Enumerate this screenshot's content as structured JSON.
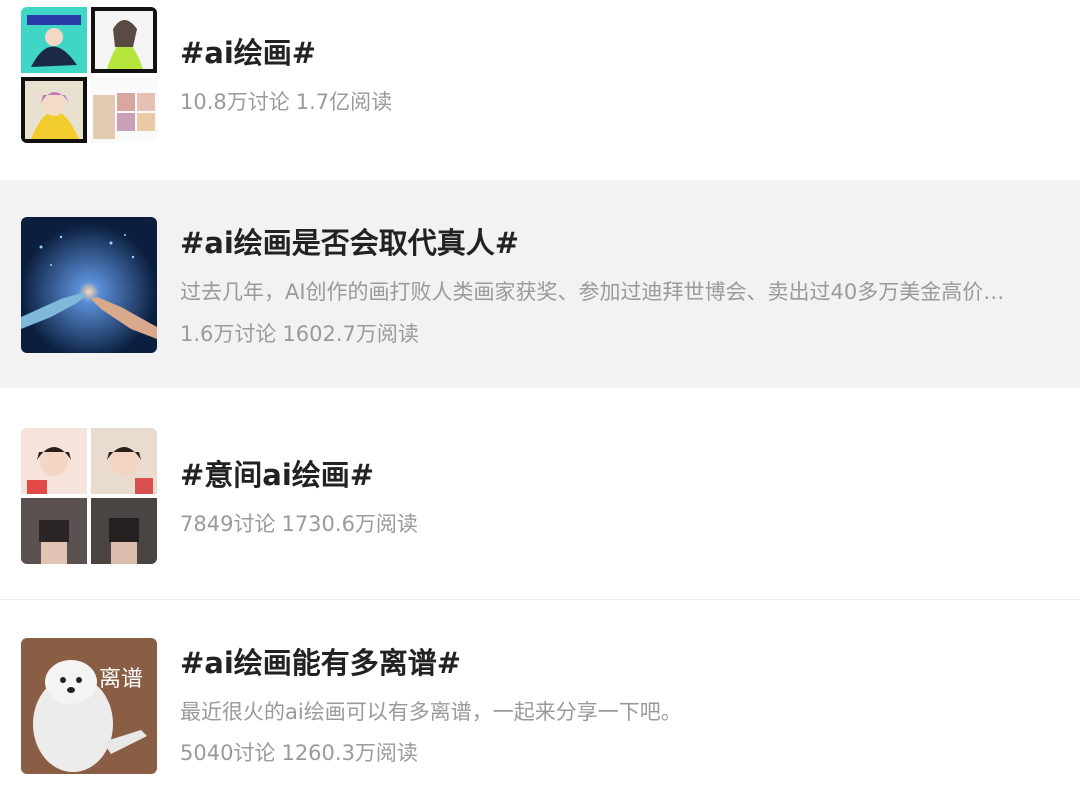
{
  "topics": [
    {
      "title": "#ai绘画#",
      "discussions": "10.8万讨论",
      "reads": "1.7亿阅读",
      "thumbnail_icon": "anime-collage-thumbnail"
    },
    {
      "title": "#ai绘画是否会取代真人#",
      "description": "过去几年，AI创作的画打败人类画家获奖、参加过迪拜世博会、卖出过40多万美金高价…",
      "discussions": "1.6万讨论",
      "reads": "1602.7万阅读",
      "thumbnail_icon": "robot-human-hands-thumbnail"
    },
    {
      "title": "#意间ai绘画#",
      "discussions": "7849讨论",
      "reads": "1730.6万阅读",
      "thumbnail_icon": "portrait-grid-thumbnail"
    },
    {
      "title": "#ai绘画能有多离谱#",
      "description": "最近很火的ai绘画可以有多离谱，一起来分享一下吧。",
      "discussions": "5040讨论",
      "reads": "1260.3万阅读",
      "thumbnail_icon": "dog-meme-thumbnail",
      "thumbnail_text": "离谱"
    }
  ],
  "colors": {
    "title": "#222222",
    "meta": "#9a9a9a",
    "highlight_bg": "#f2f2f2"
  }
}
